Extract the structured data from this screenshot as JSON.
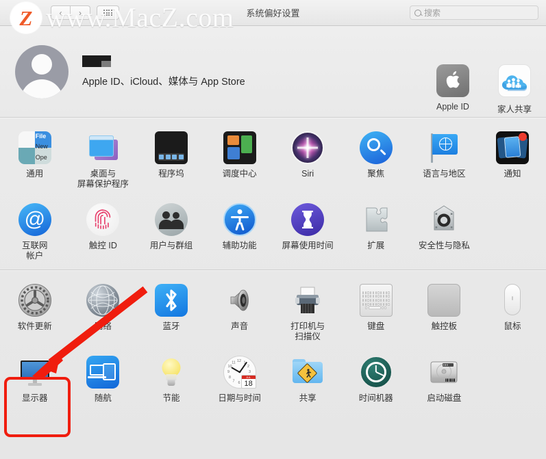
{
  "window": {
    "title": "系统偏好设置",
    "nav": {
      "back": "‹",
      "forward": "›",
      "show_all": "grid-icon"
    },
    "search": {
      "placeholder": "搜索",
      "value": ""
    }
  },
  "watermark": {
    "logo_letter": "Z",
    "text": "www.MacZ.com",
    "logo_color": "#ef5a28"
  },
  "account": {
    "name_redacted": "",
    "subtitle": "Apple ID、iCloud、媒体与 App Store",
    "panes": [
      {
        "label": "Apple ID",
        "icon": "apple-id-icon"
      },
      {
        "label": "家人共享",
        "icon": "family-sharing-icon"
      }
    ]
  },
  "rows": [
    [
      {
        "label": "通用",
        "icon": "general-icon"
      },
      {
        "label": "桌面与\n屏幕保护程序",
        "icon": "desktop-screensaver-icon"
      },
      {
        "label": "程序坞",
        "icon": "dock-icon"
      },
      {
        "label": "调度中心",
        "icon": "mission-control-icon"
      },
      {
        "label": "Siri",
        "icon": "siri-icon"
      },
      {
        "label": "聚焦",
        "icon": "spotlight-icon"
      },
      {
        "label": "语言与地区",
        "icon": "language-region-icon"
      },
      {
        "label": "通知",
        "icon": "notifications-icon"
      }
    ],
    [
      {
        "label": "互联网\n帐户",
        "icon": "internet-accounts-icon"
      },
      {
        "label": "触控 ID",
        "icon": "touch-id-icon"
      },
      {
        "label": "用户与群组",
        "icon": "users-groups-icon"
      },
      {
        "label": "辅助功能",
        "icon": "accessibility-icon"
      },
      {
        "label": "屏幕使用时间",
        "icon": "screen-time-icon"
      },
      {
        "label": "扩展",
        "icon": "extensions-icon"
      },
      {
        "label": "安全性与隐私",
        "icon": "security-privacy-icon"
      },
      {
        "label": "",
        "icon": ""
      }
    ],
    [
      {
        "label": "软件更新",
        "icon": "software-update-icon"
      },
      {
        "label": "网络",
        "icon": "network-icon"
      },
      {
        "label": "蓝牙",
        "icon": "bluetooth-icon"
      },
      {
        "label": "声音",
        "icon": "sound-icon"
      },
      {
        "label": "打印机与\n扫描仪",
        "icon": "printers-scanners-icon"
      },
      {
        "label": "键盘",
        "icon": "keyboard-icon"
      },
      {
        "label": "触控板",
        "icon": "trackpad-icon"
      },
      {
        "label": "鼠标",
        "icon": "mouse-icon"
      }
    ],
    [
      {
        "label": "显示器",
        "icon": "displays-icon"
      },
      {
        "label": "随航",
        "icon": "sidecar-icon"
      },
      {
        "label": "节能",
        "icon": "energy-saver-icon"
      },
      {
        "label": "日期与时间",
        "icon": "date-time-icon"
      },
      {
        "label": "共享",
        "icon": "sharing-icon"
      },
      {
        "label": "时间机器",
        "icon": "time-machine-icon"
      },
      {
        "label": "启动磁盘",
        "icon": "startup-disk-icon"
      },
      {
        "label": "",
        "icon": ""
      }
    ]
  ],
  "date_time_icon": {
    "calendar_month": "JUL",
    "calendar_day": "18"
  },
  "annotations": {
    "highlight_target": "显示器",
    "highlight_color": "#f01d0e",
    "arrow_color": "#f01d0e"
  }
}
